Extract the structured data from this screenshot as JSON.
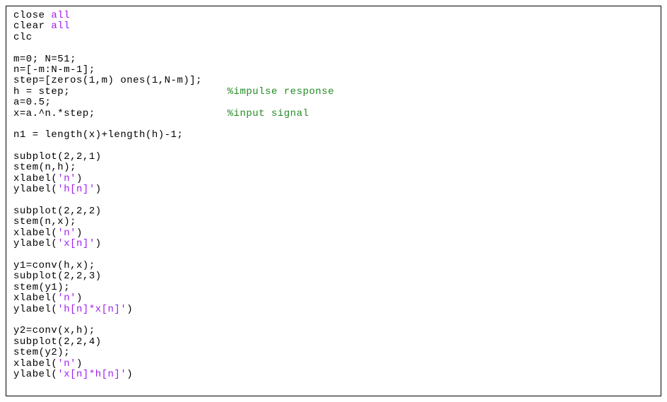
{
  "code": {
    "l1a": "close ",
    "l1b": "all",
    "l2a": "clear ",
    "l2b": "all",
    "l3": "clc",
    "l4": "",
    "l5": "m=0; N=51;",
    "l6": "n=[-m:N-m-1];",
    "l7": "step=[zeros(1,m) ones(1,N-m)];",
    "l8a": "h = step;                         ",
    "l8b": "%impulse response",
    "l9": "a=0.5;",
    "l10a": "x=a.^n.*step;                     ",
    "l10b": "%input signal",
    "l11": "",
    "l12": "n1 = length(x)+length(h)-1;",
    "l13": "",
    "l14": "subplot(2,2,1)",
    "l15": "stem(n,h);",
    "l16a": "xlabel(",
    "l16b": "'n'",
    "l16c": ")",
    "l17a": "ylabel(",
    "l17b": "'h[n]'",
    "l17c": ")",
    "l18": "",
    "l19": "subplot(2,2,2)",
    "l20": "stem(n,x);",
    "l21a": "xlabel(",
    "l21b": "'n'",
    "l21c": ")",
    "l22a": "ylabel(",
    "l22b": "'x[n]'",
    "l22c": ")",
    "l23": "",
    "l24": "y1=conv(h,x);",
    "l25": "subplot(2,2,3)",
    "l26": "stem(y1);",
    "l27a": "xlabel(",
    "l27b": "'n'",
    "l27c": ")",
    "l28a": "ylabel(",
    "l28b": "'h[n]*x[n]'",
    "l28c": ")",
    "l29": "",
    "l30": "y2=conv(x,h);",
    "l31": "subplot(2,2,4)",
    "l32": "stem(y2);",
    "l33a": "xlabel(",
    "l33b": "'n'",
    "l33c": ")",
    "l34a": "ylabel(",
    "l34b": "'x[n]*h[n]'",
    "l34c": ")",
    "l35": ""
  }
}
